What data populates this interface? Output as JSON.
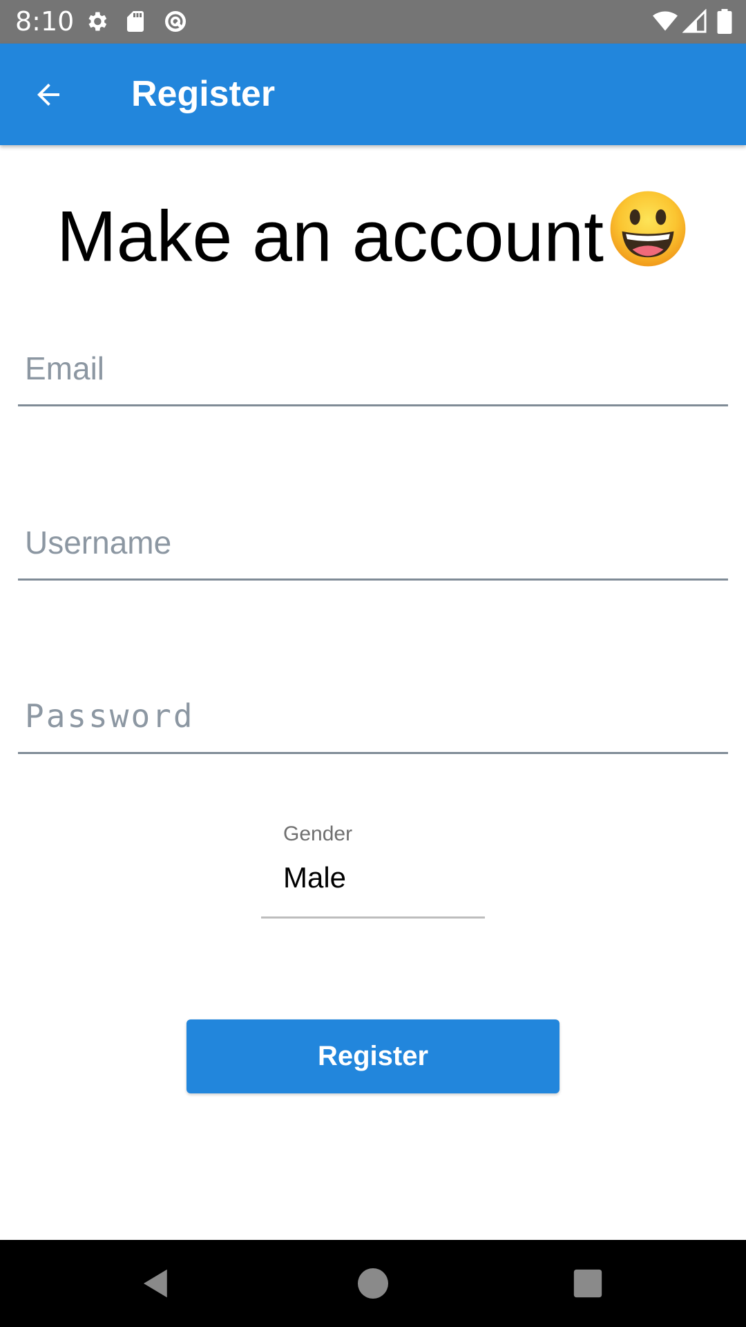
{
  "status_bar": {
    "time": "8:10",
    "left_icons": [
      "gear-icon",
      "sd-card-icon",
      "sync-blocked-icon"
    ],
    "right_icons": [
      "wifi-icon",
      "cell-signal-icon",
      "battery-icon"
    ]
  },
  "app_bar": {
    "title": "Register",
    "back_icon": "arrow-back-icon"
  },
  "heading": {
    "text": "Make an account",
    "emoji_icon": "grinning-face-icon"
  },
  "form": {
    "email": {
      "placeholder": "Email",
      "value": ""
    },
    "username": {
      "placeholder": "Username",
      "value": ""
    },
    "password": {
      "placeholder": "Password",
      "value": ""
    },
    "gender": {
      "label": "Gender",
      "selected": "Male"
    },
    "submit_label": "Register"
  },
  "nav_bar": {
    "icons": [
      "back-triangle-icon",
      "home-circle-icon",
      "recents-square-icon"
    ]
  },
  "colors": {
    "accent": "#2286DC",
    "status_bar": "#757575",
    "nav_bar": "#000000"
  }
}
